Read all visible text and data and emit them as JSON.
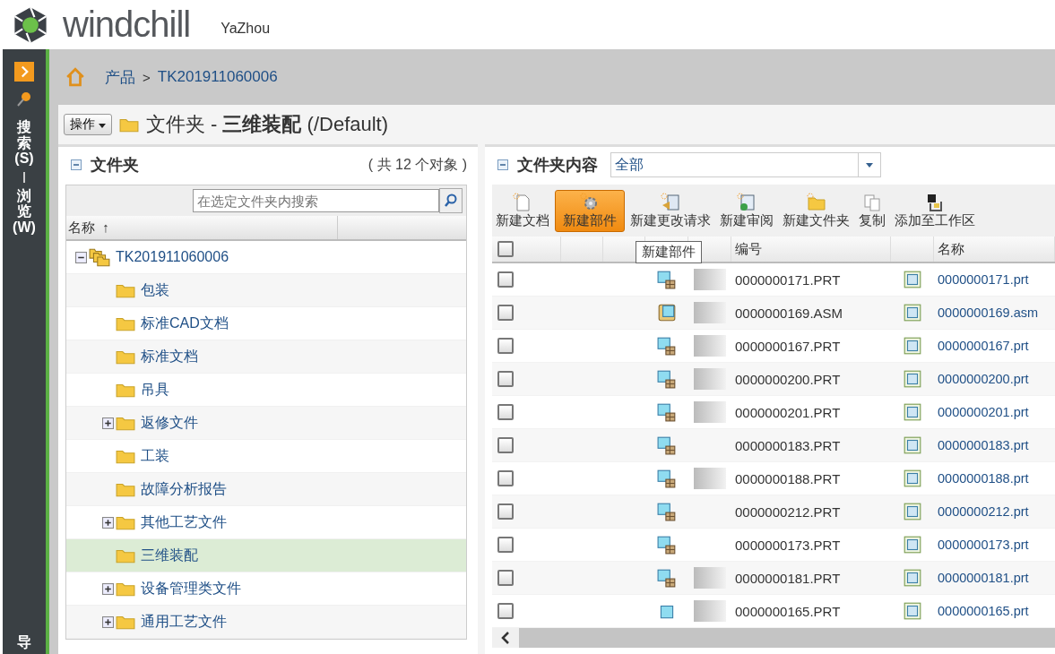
{
  "header": {
    "brand": "windchill",
    "user": "YaZhou"
  },
  "side_nav": {
    "tabs": [
      {
        "label": "搜索(S)"
      },
      {
        "label": "浏览(W)"
      }
    ],
    "bottom_label": "导"
  },
  "breadcrumb": [
    "产品",
    "TK201911060006"
  ],
  "breadcrumb_separator": ">",
  "page_title": {
    "actions_label": "操作",
    "prefix": "文件夹 - ",
    "folder": "三维装配",
    "path": "(/Default)"
  },
  "folder_panel": {
    "title": "文件夹",
    "count": "( 共 12 个对象 )",
    "search_placeholder": "在选定文件夹内搜索",
    "column": "名称",
    "sort_mark": "↑",
    "tree": {
      "label": "TK201911060006",
      "expanded": true,
      "children": [
        {
          "label": "包装",
          "expandable": false,
          "selected": false
        },
        {
          "label": "标准CAD文档",
          "expandable": false,
          "selected": false
        },
        {
          "label": "标准文档",
          "expandable": false,
          "selected": false
        },
        {
          "label": "吊具",
          "expandable": false,
          "selected": false
        },
        {
          "label": "返修文件",
          "expandable": true,
          "selected": false
        },
        {
          "label": "工装",
          "expandable": false,
          "selected": false
        },
        {
          "label": "故障分析报告",
          "expandable": false,
          "selected": false
        },
        {
          "label": "其他工艺文件",
          "expandable": true,
          "selected": false
        },
        {
          "label": "三维装配",
          "expandable": false,
          "selected": true
        },
        {
          "label": "设备管理类文件",
          "expandable": true,
          "selected": false
        },
        {
          "label": "通用工艺文件",
          "expandable": true,
          "selected": false
        }
      ]
    }
  },
  "content_panel": {
    "title": "文件夹内容",
    "view": "全部",
    "toolbar": [
      {
        "label": "新建文档",
        "kind": "document",
        "hovered": false
      },
      {
        "label": "新建部件",
        "kind": "part",
        "hovered": true
      },
      {
        "label": "新建更改请求",
        "kind": "change",
        "hovered": false
      },
      {
        "label": "新建审阅",
        "kind": "review",
        "hovered": false
      },
      {
        "label": "新建文件夹",
        "kind": "folder",
        "hovered": false
      },
      {
        "label": "复制",
        "kind": "copy",
        "hovered": false
      },
      {
        "label": "添加至工作区",
        "kind": "workspace",
        "hovered": false
      }
    ],
    "tooltip": "新建部件",
    "columns": [
      "编号",
      "名称"
    ],
    "select_all_checked": false,
    "rows": [
      {
        "kind": "part",
        "thumbnail": true,
        "number": "0000000171.PRT",
        "name": "0000000171.prt",
        "checked": false
      },
      {
        "kind": "assembly",
        "thumbnail": true,
        "number": "0000000169.ASM",
        "name": "0000000169.asm",
        "checked": false
      },
      {
        "kind": "part",
        "thumbnail": true,
        "number": "0000000167.PRT",
        "name": "0000000167.prt",
        "checked": false
      },
      {
        "kind": "part",
        "thumbnail": true,
        "number": "0000000200.PRT",
        "name": "0000000200.prt",
        "checked": false
      },
      {
        "kind": "part",
        "thumbnail": true,
        "number": "0000000201.PRT",
        "name": "0000000201.prt",
        "checked": false
      },
      {
        "kind": "part",
        "thumbnail": false,
        "number": "0000000183.PRT",
        "name": "0000000183.prt",
        "checked": false
      },
      {
        "kind": "part",
        "thumbnail": true,
        "number": "0000000188.PRT",
        "name": "0000000188.prt",
        "checked": false
      },
      {
        "kind": "part",
        "thumbnail": false,
        "number": "0000000212.PRT",
        "name": "0000000212.prt",
        "checked": false
      },
      {
        "kind": "part",
        "thumbnail": false,
        "number": "0000000173.PRT",
        "name": "0000000173.prt",
        "checked": false
      },
      {
        "kind": "part",
        "thumbnail": true,
        "number": "0000000181.PRT",
        "name": "0000000181.prt",
        "checked": false
      },
      {
        "kind": "simple-part",
        "thumbnail": true,
        "number": "0000000165.PRT",
        "name": "0000000165.prt",
        "checked": false
      }
    ]
  }
}
